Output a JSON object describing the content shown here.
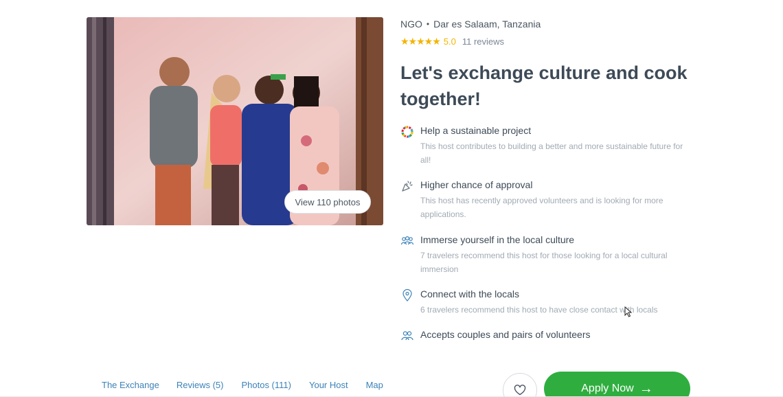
{
  "header": {
    "type": "NGO",
    "separator": "•",
    "location": "Dar es Salaam, Tanzania"
  },
  "rating": {
    "stars": "★★★★★",
    "value": "5.0",
    "reviews": "11 reviews"
  },
  "title": "Let's exchange culture and cook together!",
  "photo": {
    "view_label": "View 110 photos"
  },
  "features": [
    {
      "icon": "sustainability-icon",
      "title": "Help a sustainable project",
      "desc": "This host contributes to building a better and more sustainable future for all!"
    },
    {
      "icon": "confetti-icon",
      "title": "Higher chance of approval",
      "desc": "This host has recently approved volunteers and is looking for more applications."
    },
    {
      "icon": "group-icon",
      "title": "Immerse yourself in the local culture",
      "desc": "7 travelers recommend this host for those looking for a local cultural immersion"
    },
    {
      "icon": "location-pin-icon",
      "title": "Connect with the locals",
      "desc": "6 travelers recommend this host to have close contact with locals"
    },
    {
      "icon": "couple-icon",
      "title": "Accepts couples and pairs of volunteers",
      "desc": ""
    }
  ],
  "tabs": [
    "The Exchange",
    "Reviews (5)",
    "Photos (111)",
    "Your Host",
    "Map"
  ],
  "actions": {
    "apply_label": "Apply Now",
    "arrow": "→"
  },
  "colors": {
    "accent_green": "#2fae3f",
    "star_yellow": "#f4b400",
    "link_blue": "#3b82b8"
  }
}
